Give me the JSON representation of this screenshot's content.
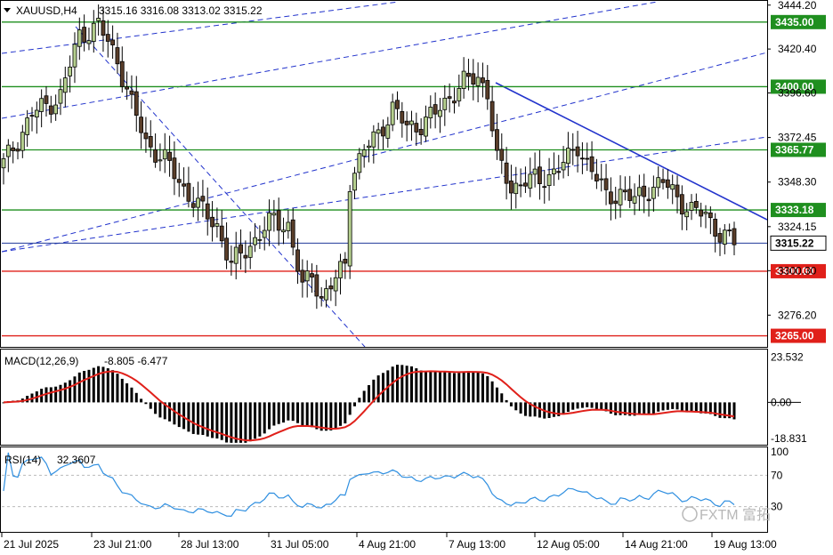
{
  "header": {
    "symbol": "XAUUSD,H4",
    "ohlc": "3315.16 3316.08 3313.02 3315.22"
  },
  "watermark": "FXTM 富拓",
  "colors": {
    "bull_candle": "#b5cf8e",
    "bear_candle": "#5a3e2a",
    "hline_green": "#1f8f1f",
    "hline_red": "#e0201a",
    "trend_blue": "#2233cc",
    "macd_signal": "#e0201a",
    "rsi_line": "#2f8fe0",
    "bid_line": "#203a9a"
  },
  "chart_data": [
    {
      "type": "candlestick",
      "title": "XAUUSD,H4",
      "ylim": [
        3259,
        3446
      ],
      "price_ticks": [
        3444.2,
        3420.4,
        3396.6,
        3372.45,
        3348.3,
        3324.15,
        3300.3,
        3276.2
      ],
      "x_labels": [
        "21 Jul 2025",
        "23 Jul 21:00",
        "28 Jul 13:00",
        "31 Jul 05:00",
        "4 Aug 21:00",
        "7 Aug 13:00",
        "12 Aug 05:00",
        "14 Aug 21:00",
        "19 Aug 13:00"
      ],
      "horizontal_levels": [
        {
          "label": "3435.00",
          "price": 3435.0,
          "color": "#1f8f1f"
        },
        {
          "label": "3400.00",
          "price": 3400.0,
          "color": "#1f8f1f"
        },
        {
          "label": "3365.77",
          "price": 3365.77,
          "color": "#1f8f1f"
        },
        {
          "label": "3333.18",
          "price": 3333.18,
          "color": "#1f8f1f"
        },
        {
          "label": "3315.22",
          "price": 3315.22,
          "color": "#203a9a",
          "current": true
        },
        {
          "label": "3300.00",
          "price": 3300.0,
          "color": "#e0201a"
        },
        {
          "label": "3265.00",
          "price": 3265.0,
          "color": "#e0201a"
        }
      ],
      "close_path": [
        [
          0,
          3358
        ],
        [
          6,
          3385
        ],
        [
          12,
          3395
        ],
        [
          16,
          3428
        ],
        [
          20,
          3433
        ],
        [
          24,
          3415
        ],
        [
          27,
          3390
        ],
        [
          30,
          3370
        ],
        [
          34,
          3360
        ],
        [
          38,
          3345
        ],
        [
          42,
          3332
        ],
        [
          45,
          3325
        ],
        [
          48,
          3303
        ],
        [
          51,
          3312
        ],
        [
          54,
          3320
        ],
        [
          57,
          3328
        ],
        [
          60,
          3325
        ],
        [
          63,
          3290
        ],
        [
          65,
          3300
        ],
        [
          67,
          3285
        ],
        [
          70,
          3295
        ],
        [
          72,
          3305
        ],
        [
          73,
          3350
        ],
        [
          76,
          3365
        ],
        [
          79,
          3375
        ],
        [
          82,
          3388
        ],
        [
          85,
          3378
        ],
        [
          88,
          3380
        ],
        [
          91,
          3385
        ],
        [
          94,
          3395
        ],
        [
          97,
          3402
        ],
        [
          100,
          3405
        ],
        [
          102,
          3398
        ],
        [
          104,
          3360
        ],
        [
          107,
          3345
        ],
        [
          110,
          3350
        ],
        [
          113,
          3348
        ],
        [
          116,
          3355
        ],
        [
          119,
          3360
        ],
        [
          121,
          3368
        ],
        [
          124,
          3355
        ],
        [
          127,
          3340
        ],
        [
          130,
          3343
        ],
        [
          133,
          3338
        ],
        [
          136,
          3345
        ],
        [
          139,
          3348
        ],
        [
          142,
          3340
        ],
        [
          145,
          3333
        ],
        [
          148,
          3330
        ],
        [
          151,
          3321
        ],
        [
          154,
          3315
        ]
      ]
    },
    {
      "type": "histogram",
      "title": "MACD(12,26,9)",
      "values_text": "-8.805 -6.477",
      "macd_value": -8.805,
      "signal_value": -6.477,
      "ylim": [
        -22,
        27
      ],
      "ticks": [
        23.532,
        0.0,
        -18.831
      ],
      "tick_labels": [
        "23.532",
        "0.00",
        "-18.831"
      ]
    },
    {
      "type": "line",
      "title": "RSI(14)",
      "value_text": "32.3607",
      "value": 32.3607,
      "ylim": [
        0,
        100
      ],
      "ticks": [
        100,
        70,
        30
      ],
      "tick_labels": [
        "100",
        "70",
        "30"
      ],
      "levels": [
        70,
        30
      ]
    }
  ]
}
